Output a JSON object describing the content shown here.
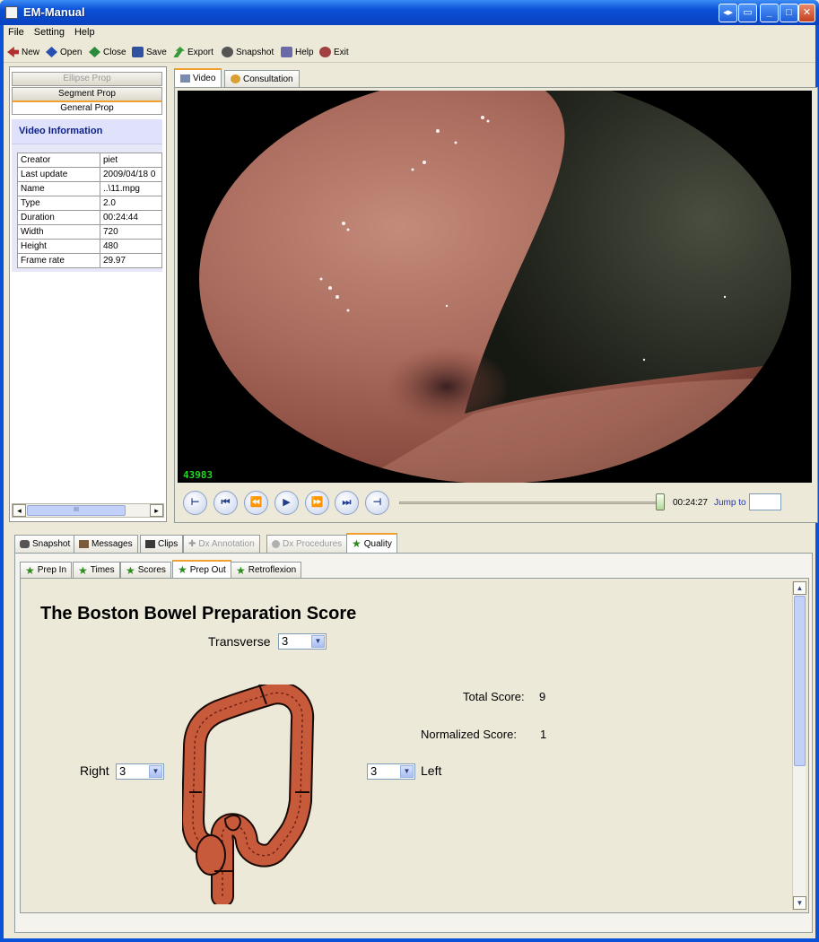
{
  "window": {
    "title": "EM-Manual"
  },
  "menu": [
    "File",
    "Setting",
    "Help"
  ],
  "toolbar": [
    {
      "label": "New",
      "icon": "new-icon",
      "color": "#b03030"
    },
    {
      "label": "Open",
      "icon": "open-icon",
      "color": "#2a4fb0"
    },
    {
      "label": "Close",
      "icon": "close-icon",
      "color": "#2a8a3a"
    },
    {
      "label": "Save",
      "icon": "save-icon",
      "color": "#3050a0"
    },
    {
      "label": "Export",
      "icon": "export-icon",
      "color": "#3a9a3a"
    },
    {
      "label": "Snapshot",
      "icon": "camera-icon",
      "color": "#555555"
    },
    {
      "label": "Help",
      "icon": "help-icon",
      "color": "#6a6aa8"
    },
    {
      "label": "Exit",
      "icon": "exit-icon",
      "color": "#a04040"
    }
  ],
  "left_panel": {
    "tabs": [
      "Ellipse Prop",
      "Segment Prop",
      "General Prop"
    ],
    "heading": "Video Information",
    "rows": [
      {
        "key": "Creator",
        "value": "piet"
      },
      {
        "key": "Last update",
        "value": "2009/04/18 0"
      },
      {
        "key": "Name",
        "value": "..\\11.mpg"
      },
      {
        "key": "Type",
        "value": "2.0"
      },
      {
        "key": "Duration",
        "value": "00:24:44"
      },
      {
        "key": "Width",
        "value": "720"
      },
      {
        "key": "Height",
        "value": "480"
      },
      {
        "key": "Frame rate",
        "value": "29.97"
      }
    ],
    "scroll_glyph": "III"
  },
  "video_tabs": [
    "Video",
    "Consultation"
  ],
  "video": {
    "frame_number": "43983",
    "time": "00:24:27",
    "jump_to_label": "Jump to",
    "jump_value": "",
    "progress": 0.99
  },
  "bottom_tabs": [
    "Snapshot",
    "Messages",
    "Clips",
    "Dx Annotation",
    "Dx Procedures",
    "Quality"
  ],
  "quality_tabs": [
    "Prep In",
    "Times",
    "Scores",
    "Prep Out",
    "Retroflexion"
  ],
  "bbps": {
    "title": "The Boston Bowel Preparation Score",
    "transverse_label": "Transverse",
    "transverse_value": "3",
    "right_label": "Right",
    "right_value": "3",
    "left_label": "Left",
    "left_value": "3",
    "total_label": "Total Score:",
    "total_value": "9",
    "normalized_label": "Normalized Score:",
    "normalized_value": "1"
  },
  "colors": {
    "titlebar": "#0a53d8",
    "tab_highlight": "#f0a030",
    "colon": "#c85a3c",
    "star": "#2d8a1e",
    "frame_counter": "#1fd81f"
  }
}
